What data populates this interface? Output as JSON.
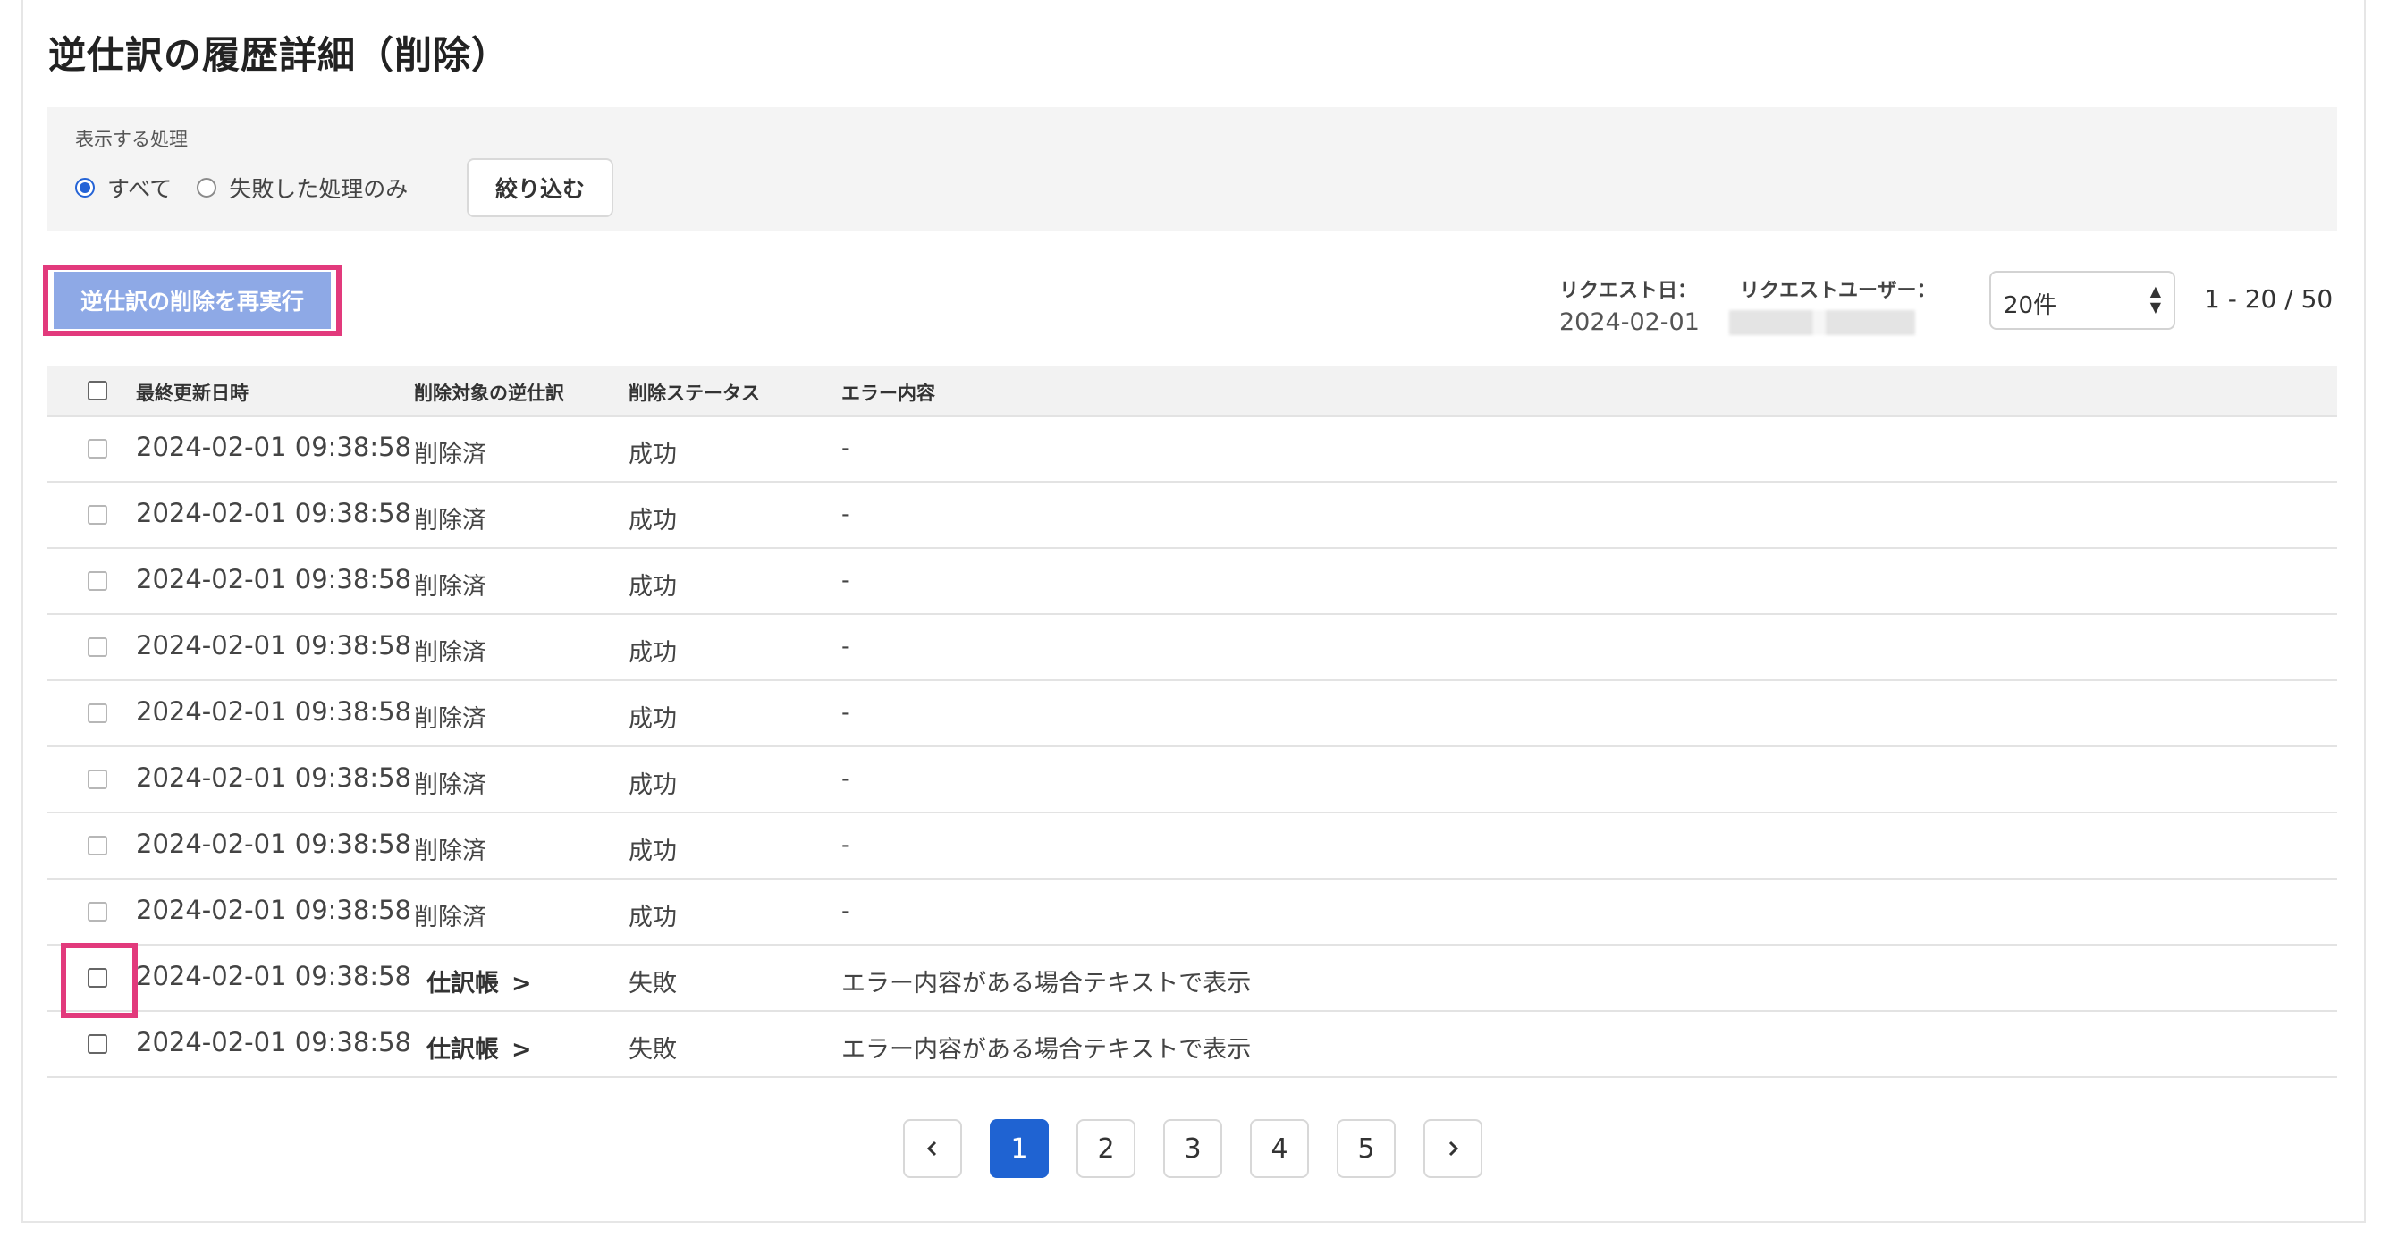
{
  "page": {
    "title": "逆仕訳の履歴詳細（削除）"
  },
  "filter": {
    "label": "表示する処理",
    "options": [
      "すべて",
      "失敗した処理のみ"
    ],
    "selected": "すべて",
    "button_label": "絞り込む"
  },
  "toolbar": {
    "rerun_label": "逆仕訳の削除を再実行",
    "request_date_label": "リクエスト日：",
    "request_date_value": "2024-02-01",
    "request_user_label": "リクエストユーザー：",
    "per_page": "20件",
    "range_text": "1 - 20 / 50"
  },
  "table": {
    "headers": [
      "最終更新日時",
      "削除対象の逆仕訳",
      "削除ステータス",
      "エラー内容"
    ],
    "rows": [
      {
        "date": "2024-02-01 09:38:58",
        "target": "削除済",
        "status": "成功",
        "error": "-"
      },
      {
        "date": "2024-02-01 09:38:58",
        "target": "削除済",
        "status": "成功",
        "error": "-"
      },
      {
        "date": "2024-02-01 09:38:58",
        "target": "削除済",
        "status": "成功",
        "error": "-"
      },
      {
        "date": "2024-02-01 09:38:58",
        "target": "削除済",
        "status": "成功",
        "error": "-"
      },
      {
        "date": "2024-02-01 09:38:58",
        "target": "削除済",
        "status": "成功",
        "error": "-"
      },
      {
        "date": "2024-02-01 09:38:58",
        "target": "削除済",
        "status": "成功",
        "error": "-"
      },
      {
        "date": "2024-02-01 09:38:58",
        "target": "削除済",
        "status": "成功",
        "error": "-"
      },
      {
        "date": "2024-02-01 09:38:58",
        "target": "削除済",
        "status": "成功",
        "error": "-"
      },
      {
        "date": "2024-02-01 09:38:58",
        "target": "仕訳帳",
        "status": "失敗",
        "error": "エラー内容がある場合テキストで表示"
      },
      {
        "date": "2024-02-01 09:38:58",
        "target": "仕訳帳",
        "status": "失敗",
        "error": "エラー内容がある場合テキストで表示"
      }
    ]
  },
  "pagination": {
    "pages": [
      "1",
      "2",
      "3",
      "4",
      "5"
    ],
    "current": "1"
  },
  "colors": {
    "accent": "#1f63d2",
    "highlight": "#e23a7c",
    "rerun_button": "#8ea9e6"
  }
}
